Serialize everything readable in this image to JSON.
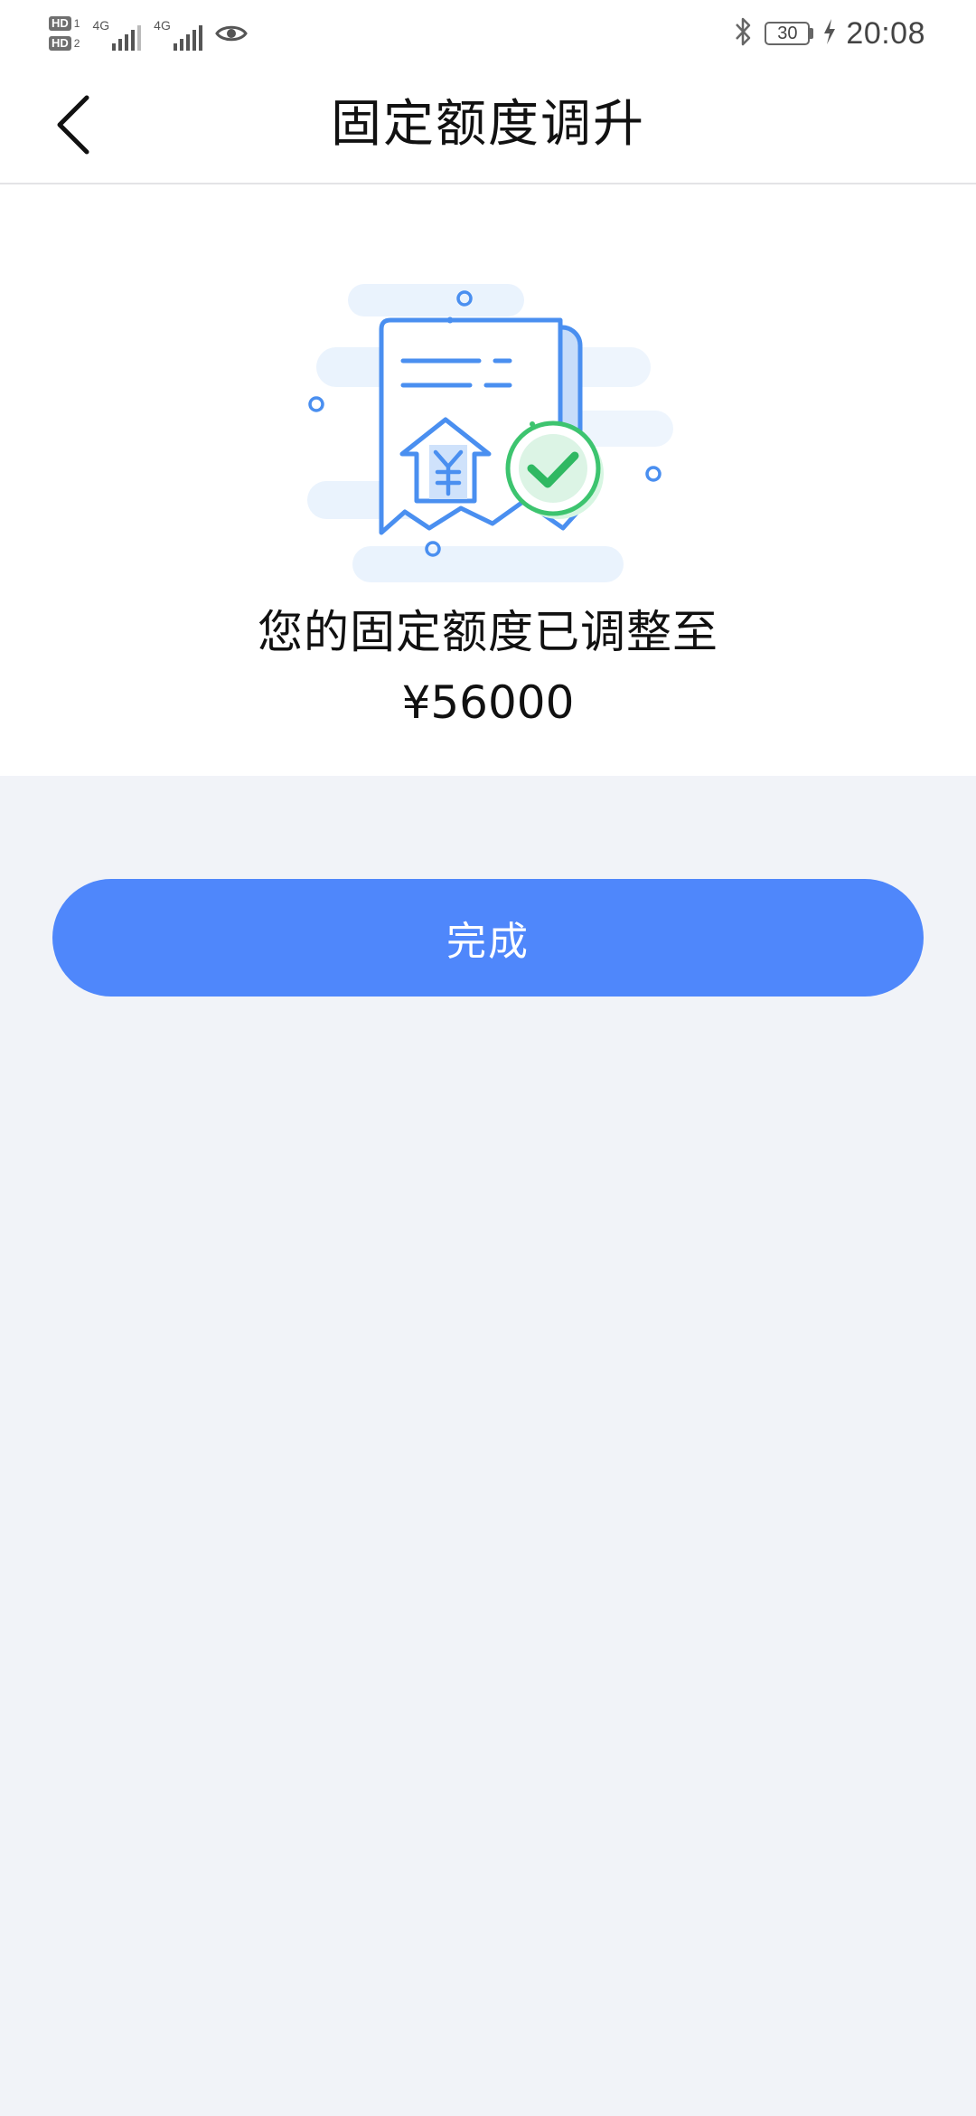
{
  "status_bar": {
    "sim1_badge": "HD",
    "sim1_index": "1",
    "sim2_badge": "HD",
    "sim2_index": "2",
    "network1": "4G",
    "network2": "4G",
    "battery_level": "30",
    "time": "20:08",
    "icons": [
      "signal-icon",
      "eye-icon",
      "bluetooth-icon",
      "battery-icon",
      "charging-icon"
    ]
  },
  "header": {
    "title": "固定额度调升",
    "back_icon": "chevron-left-icon"
  },
  "result": {
    "illustration": "receipt-yuan-upgrade-check-illustration",
    "message": "您的固定额度已调整至",
    "amount": "¥56000"
  },
  "actions": {
    "done_label": "完成"
  },
  "colors": {
    "accent": "#4f87fb",
    "page_background": "#f1f3f8",
    "card_background": "#ffffff",
    "illustration_blue": "#4a8ff0",
    "success_green": "#3dc46f"
  }
}
